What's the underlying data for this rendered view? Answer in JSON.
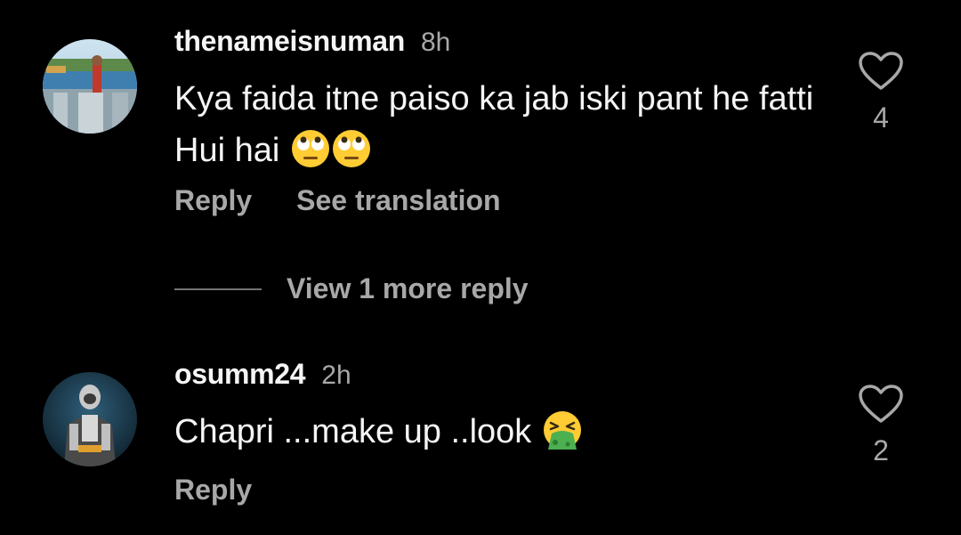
{
  "comments": [
    {
      "username": "thenameisnuman",
      "timestamp": "8h",
      "text": "Kya faida itne paiso ka jab iski pant he fatti Hui hai",
      "emojis": [
        "face-with-rolling-eyes-icon",
        "face-with-rolling-eyes-icon"
      ],
      "actions": {
        "reply": "Reply",
        "translate": "See translation"
      },
      "likes": "4",
      "view_more_replies": "View 1 more reply"
    },
    {
      "username": "osumm24",
      "timestamp": "2h",
      "text": "Chapri ...make up ..look",
      "emojis": [
        "face-vomiting-icon"
      ],
      "actions": {
        "reply": "Reply"
      },
      "likes": "2"
    }
  ],
  "colors": {
    "background": "#000000",
    "primary_text": "#f5f5f5",
    "secondary_text": "#a8a8a8",
    "divider": "#737373",
    "emoji_yellow": "#ffcc33",
    "emoji_green": "#4caf50"
  }
}
